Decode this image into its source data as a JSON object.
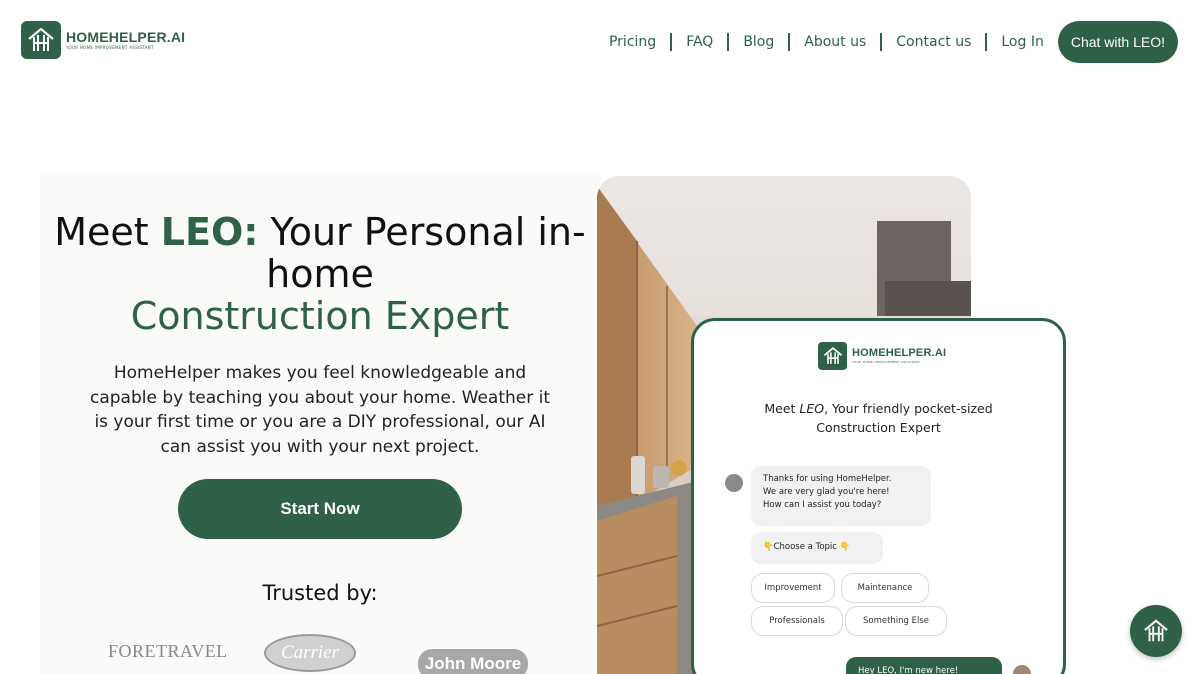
{
  "brand": {
    "name": "HOMEHELPER.AI",
    "tagline": "YOUR HOME IMPROVEMENT ASSISTANT",
    "color": "#2e6148"
  },
  "nav": {
    "links": [
      "Pricing",
      "FAQ",
      "Blog",
      "About us",
      "Contact us",
      "Log In"
    ],
    "cta": "Chat with LEO!"
  },
  "hero": {
    "headline_part1": "Meet ",
    "headline_leo": "LEO:",
    "headline_part2": " Your Personal in-home",
    "headline_part3": "Construction Expert",
    "description": "HomeHelper makes you feel knowledgeable and capable by teaching you about your home. Weather it is your first time or you are a DIY professional, our AI can assist you with your next project.",
    "cta": "Start Now",
    "trusted_label": "Trusted by:",
    "trusted_brands": [
      "FORETRAVEL",
      "Carrier",
      "John Moore"
    ]
  },
  "phone": {
    "brand_name": "HOMEHELPER.AI",
    "brand_tagline": "YOUR HOME IMPROVEMENT ASSISTANT",
    "title_line1_prefix": "Meet ",
    "title_leo": "LEO",
    "title_line1_suffix": ", Your friendly pocket-sized",
    "title_line2": "Construction Expert",
    "bot_message_lines": [
      "Thanks for using HomeHelper.",
      "We are very glad you're here!",
      "How can I assist you today?"
    ],
    "choose_topic": "👇Choose a Topic 👇",
    "topics": [
      "Improvement",
      "Maintenance",
      "Professionals",
      "Something Else"
    ],
    "user_message": "Hey LEO, I'm new here!"
  },
  "fab": {
    "icon": "homehelper-logo-icon"
  }
}
